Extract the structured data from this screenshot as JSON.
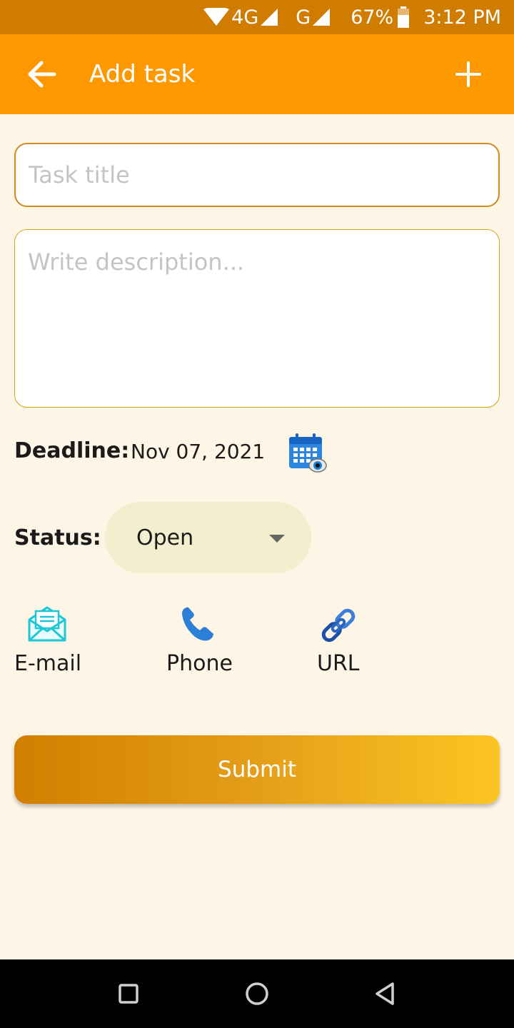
{
  "status_bar": {
    "network_4g": "4G",
    "network_g": "G",
    "battery": "67%",
    "time": "3:12 PM"
  },
  "app_bar": {
    "title": "Add task"
  },
  "form": {
    "title_placeholder": "Task title",
    "title_value": "",
    "description_placeholder": "Write description...",
    "description_value": "",
    "deadline_label": "Deadline:",
    "deadline_value": "Nov 07, 2021",
    "status_label": "Status:",
    "status_value": "Open",
    "submit_label": "Submit"
  },
  "contacts": [
    {
      "label": "E-mail",
      "icon": "email-icon"
    },
    {
      "label": "Phone",
      "icon": "phone-icon"
    },
    {
      "label": "URL",
      "icon": "link-icon"
    }
  ],
  "colors": {
    "status_bar": "#d07c00",
    "app_bar": "#fe9800",
    "background": "#fdf5e6",
    "status_pill": "#f3eecd",
    "submit_gradient_start": "#d17f00",
    "submit_gradient_end": "#fbc523"
  }
}
